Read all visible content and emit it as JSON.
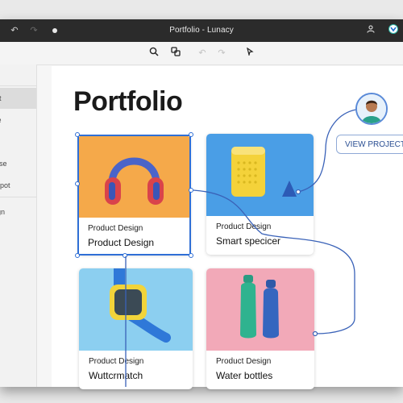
{
  "window": {
    "title": "Portfolio - Lunacy"
  },
  "titlebar": {
    "back_icon": "undo-arrow-icon",
    "forward_icon": "redo-arrow-icon",
    "dot_icon": "status-dot-icon",
    "user_icon": "user-icon",
    "app_icon": "app-logo-icon"
  },
  "toolbar": {
    "tools": [
      "search-icon",
      "component-icon",
      "undo-icon",
      "redo-icon",
      "pointer-icon"
    ]
  },
  "sidebar": {
    "items": [
      {
        "label": "e"
      },
      {
        "label": "ot"
      },
      {
        "label": "te"
      },
      {
        "label": "t"
      },
      {
        "label": "ese"
      },
      {
        "label": "Spot"
      },
      {
        "label": "ign"
      }
    ]
  },
  "page": {
    "title": "Portfolio"
  },
  "cards": [
    {
      "category": "Product Design",
      "name": "Product Design",
      "image": "headphones",
      "bg": "#f5a94a"
    },
    {
      "category": "Product Design",
      "name": "Smart specicer",
      "image": "smart-speaker",
      "bg": "#4a9ee6"
    },
    {
      "category": "Product Design",
      "name": "Wuttcrmatch",
      "image": "smartwatch",
      "bg": "#8ccff0"
    },
    {
      "category": "Product Design",
      "name": "Water bottles",
      "image": "water-bottles",
      "bg": "#f2a9b8"
    }
  ],
  "view_button": {
    "label": "VIEW PROJECT"
  },
  "colors": {
    "accent": "#2f6fd6",
    "connector": "#3a62b8"
  }
}
